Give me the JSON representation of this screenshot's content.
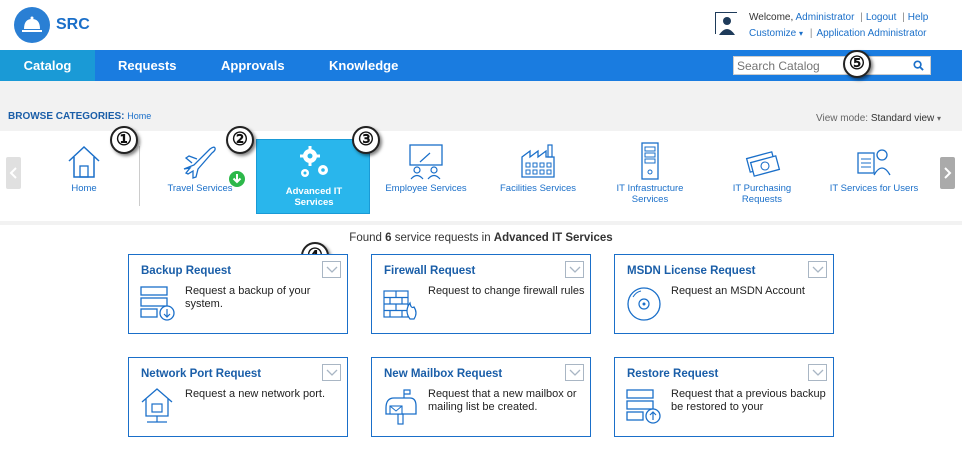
{
  "header": {
    "app_name": "SRC",
    "welcome_prefix": "Welcome,",
    "user_name": "Administrator",
    "logout": "Logout",
    "help": "Help",
    "customize": "Customize",
    "role": "Application Administrator"
  },
  "nav": {
    "items": [
      {
        "label": "Catalog"
      },
      {
        "label": "Requests"
      },
      {
        "label": "Approvals"
      },
      {
        "label": "Knowledge"
      }
    ],
    "search_placeholder": "Search Catalog"
  },
  "browse": {
    "label": "BROWSE CATEGORIES:",
    "crumb": "Home",
    "view_mode_label": "View mode:",
    "view_mode_value": "Standard view"
  },
  "categories": [
    {
      "label": "Home",
      "icon": "home-icon"
    },
    {
      "label": "Travel Services",
      "icon": "airplane-icon"
    },
    {
      "label": "Advanced IT Services",
      "icon": "gears-icon"
    },
    {
      "label": "Employee Services",
      "icon": "presentation-icon"
    },
    {
      "label": "Facilities Services",
      "icon": "factory-icon"
    },
    {
      "label": "IT Infrastructure Services",
      "icon": "server-icon"
    },
    {
      "label": "IT Purchasing Requests",
      "icon": "money-icon"
    },
    {
      "label": "IT Services for Users",
      "icon": "users-icon"
    }
  ],
  "callouts": [
    "①",
    "②",
    "③",
    "④",
    "⑤"
  ],
  "results": {
    "found_prefix": "Found",
    "count": "6",
    "found_mid": "service requests  in",
    "category": "Advanced IT Services"
  },
  "cards": [
    {
      "title": "Backup Request",
      "desc": "Request a backup of your system.",
      "icon": "backup-icon"
    },
    {
      "title": "Firewall Request",
      "desc": "Request to change firewall rules",
      "icon": "firewall-icon"
    },
    {
      "title": "MSDN License Request",
      "desc": "Request an MSDN Account",
      "icon": "disc-icon"
    },
    {
      "title": "Network Port Request",
      "desc": "Request a new network port.",
      "icon": "network-icon"
    },
    {
      "title": "New Mailbox Request",
      "desc": "Request that a new mailbox or mailing list be created.",
      "icon": "mailbox-icon"
    },
    {
      "title": "Restore Request",
      "desc": "Request that a previous backup be restored to your",
      "icon": "restore-icon"
    }
  ],
  "colors": {
    "nav_blue": "#1a7ce0",
    "active_tile": "#29b6ec",
    "link_blue": "#1a6fc9"
  }
}
